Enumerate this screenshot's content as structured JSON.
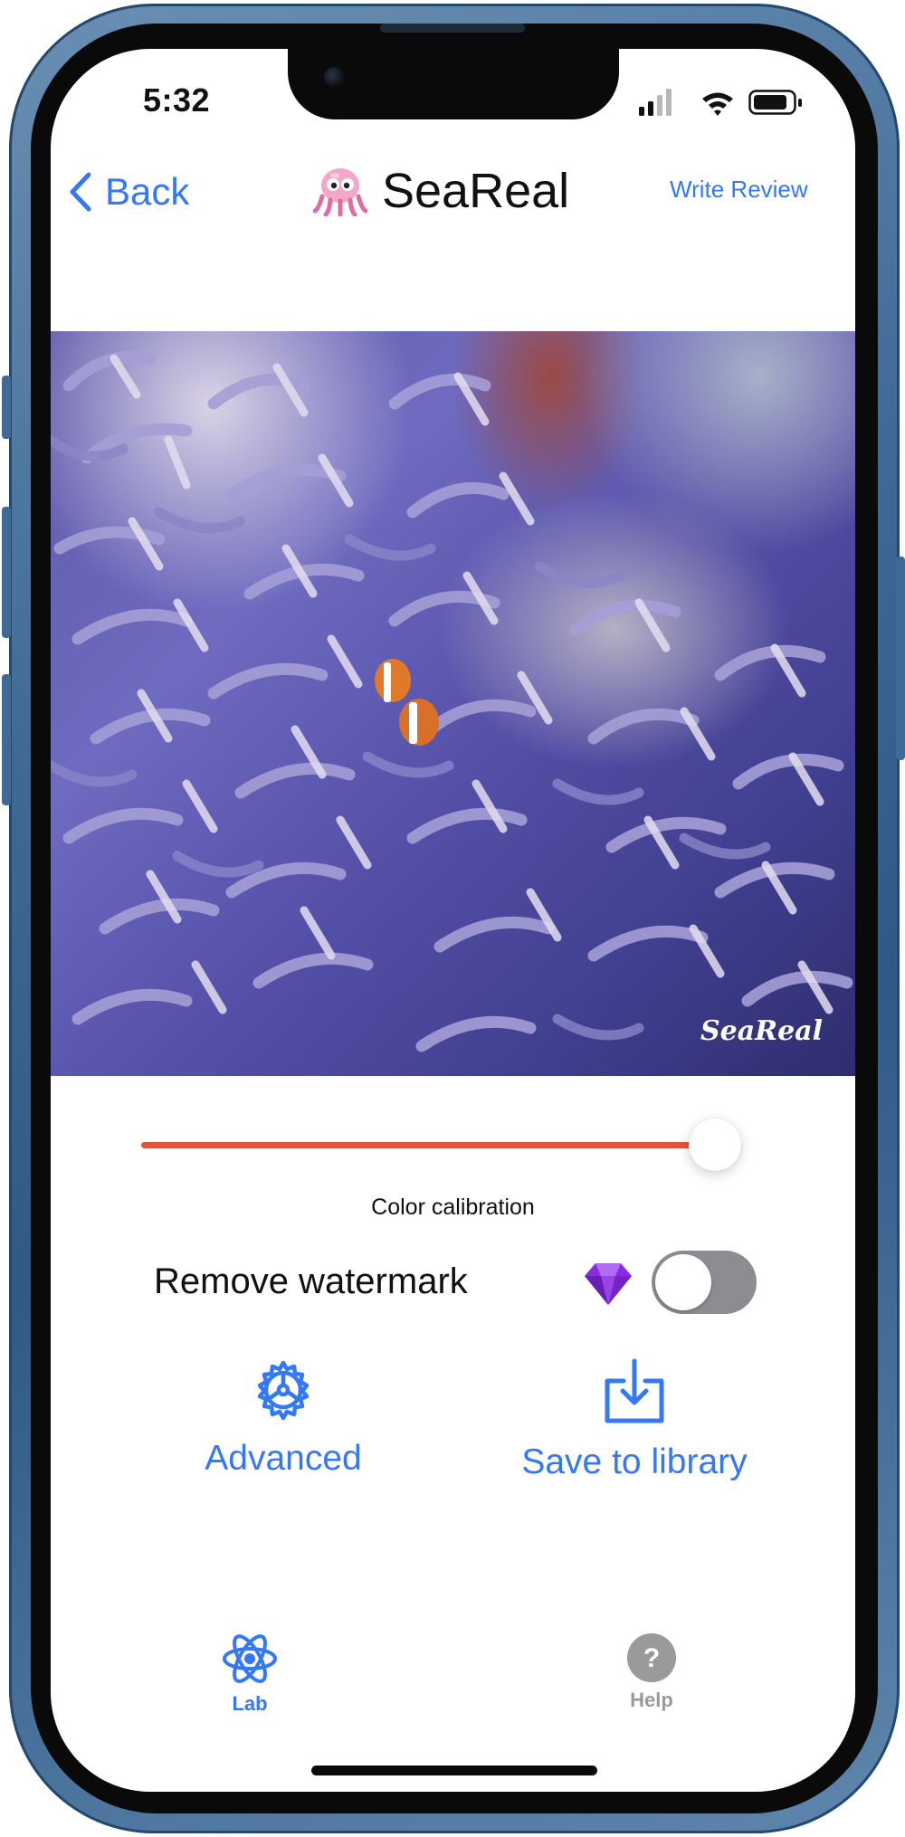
{
  "status_bar": {
    "time": "5:32"
  },
  "nav": {
    "back_label": "Back",
    "title": "SeaReal",
    "write_review_label": "Write Review"
  },
  "photo": {
    "watermark_text": "SeaReal"
  },
  "color_calibration": {
    "label": "Color calibration",
    "value_fraction": 0.96
  },
  "remove_watermark": {
    "label": "Remove watermark",
    "enabled": false
  },
  "actions": {
    "advanced_label": "Advanced",
    "save_label": "Save to library"
  },
  "tabbar": {
    "tabs": [
      {
        "label": "Lab",
        "icon": "atom-icon",
        "selected": true
      },
      {
        "label": "Help",
        "icon": "question-circle-icon",
        "selected": false
      }
    ]
  },
  "colors": {
    "accent": "#3478f6",
    "slider": "#e2533c",
    "toggle_off": "#8e8b92",
    "gem": "#8a2be2",
    "inactive_tab": "#9a9a9a"
  }
}
